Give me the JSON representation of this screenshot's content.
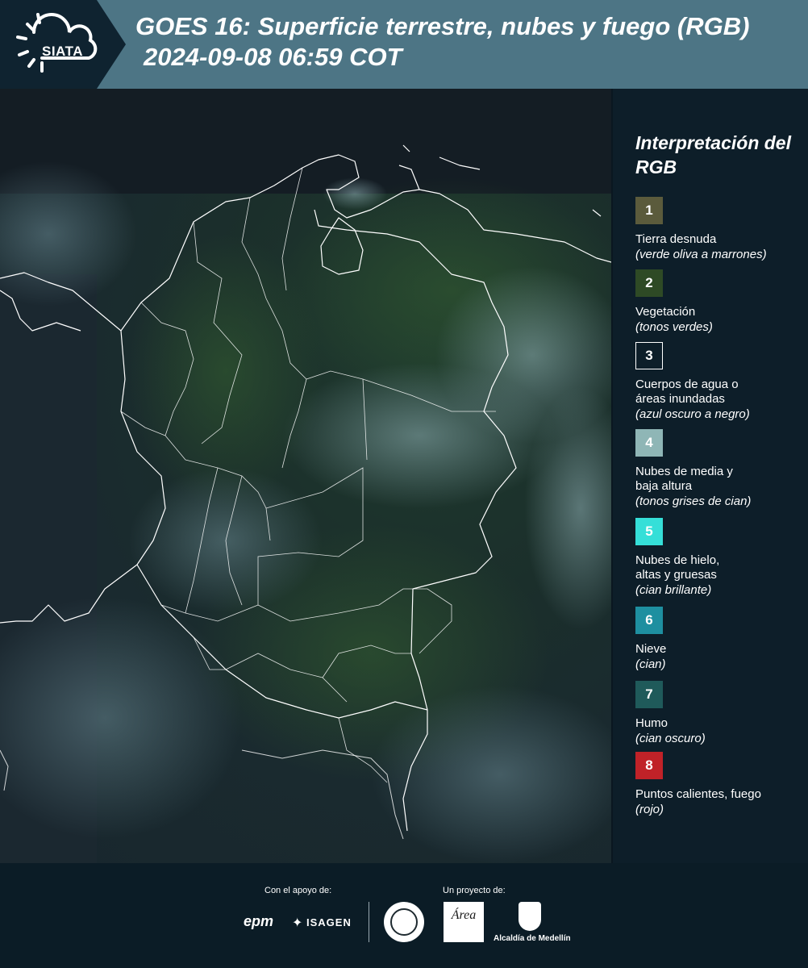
{
  "header": {
    "logo_text": "SIATA",
    "title_line1": "GOES 16: Superficie terrestre, nubes y fuego (RGB)",
    "title_line2": "2024-09-08 06:59 COT"
  },
  "legend": {
    "title": "Interpretación del RGB",
    "items": [
      {
        "number": "1",
        "label": "Tierra desnuda",
        "note": "(verde oliva a marrones)",
        "color": "#5b5b3c"
      },
      {
        "number": "2",
        "label": "Vegetación",
        "note": "(tonos verdes)",
        "color": "#2e4a25"
      },
      {
        "number": "3",
        "label": "Cuerpos de agua o\náreas inundadas",
        "note": "(azul oscuro a negro)",
        "color": "#0d1e29"
      },
      {
        "number": "4",
        "label": "Nubes de media y\nbaja altura",
        "note": "(tonos grises de cian)",
        "color": "#8fb6b6"
      },
      {
        "number": "5",
        "label": "Nubes de hielo,\naltas y gruesas",
        "note": "(cian brillante)",
        "color": "#35dfd8"
      },
      {
        "number": "6",
        "label": "Nieve",
        "note": "(cian)",
        "color": "#1e8fa0"
      },
      {
        "number": "7",
        "label": "Humo",
        "note": "(cian oscuro)",
        "color": "#1f5a5a"
      },
      {
        "number": "8",
        "label": "Puntos calientes, fuego",
        "note": "(rojo)",
        "color": "#c02228"
      }
    ]
  },
  "footer": {
    "support_label": "Con el apoyo de:",
    "project_label": "Un proyecto de:",
    "sponsor_epm": "epm",
    "sponsor_isagen": "ISAGEN",
    "amva_text": "Área",
    "alcaldia": "Alcaldía de Medellín"
  },
  "colors": {
    "header_band": "#4d7585",
    "background": "#0d1e29"
  }
}
